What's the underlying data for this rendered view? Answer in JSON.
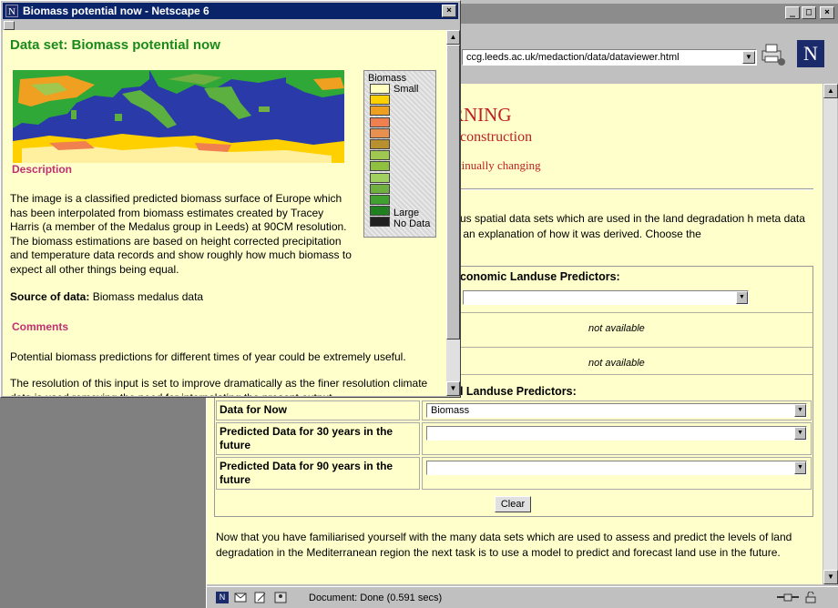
{
  "main_window": {
    "url": "ccg.leeds.ac.uk/medaction/data/dataviewer.html",
    "window_buttons": [
      "_",
      "□",
      "×"
    ],
    "warning_title": "RNING",
    "warning_subtitle": "construction",
    "warning_note": "tinually changing",
    "intro_text": "arious spatial data sets which are used in the land degradation h meta data and an explanation of how it was derived. Choose the",
    "socio_section_title": "economic Landuse Predictors:",
    "not_available_1": "not available",
    "not_available_2": "not available",
    "physical_section_title": "al Landuse Predictors:",
    "predictors": [
      {
        "label": "Data for Now",
        "value": "Biomass"
      },
      {
        "label": "Predicted Data for 30 years in the future",
        "value": ""
      },
      {
        "label": "Predicted Data for 90 years in the future",
        "value": ""
      }
    ],
    "clear_label": "Clear",
    "outro_text": "Now that you have familiarised yourself with the many data sets which are used to assess and predict the levels of land degradation in the Mediterranean region the next task is to use a model to predict and forecast land use in the future.",
    "status_text": "Document: Done (0.591 secs)",
    "logo_letter": "N"
  },
  "popup": {
    "window_title": "Biomass potential now - Netscape 6",
    "icon_letter": "N",
    "close_label": "×",
    "dataset_title": "Data set: Biomass potential now",
    "legend": {
      "title": "Biomass",
      "small_label": "Small",
      "large_label": "Large",
      "nodata_label": "No Data",
      "colors": [
        "#ffffc0",
        "#ffd000",
        "#f0a020",
        "#f08050",
        "#e89050",
        "#b89030",
        "#a0c850",
        "#90c040",
        "#a0d060",
        "#70b040",
        "#40a030",
        "#208020",
        "#202020"
      ]
    },
    "description_heading": "Description",
    "description_text": "The image is a classified predicted biomass surface of Europe which has been interpolated from biomass estimates created by Tracey Harris (a member of the Medalus group in Leeds) at 90CM resolution. The biomass estimations are based on height corrected precipitation and temperature data records and show roughly how much biomass to expect all other things being equal.",
    "source_label": "Source of data:",
    "source_value": "Biomass medalus data",
    "comments_heading": "Comments",
    "comments_text_1": "Potential biomass predictions for different times of year could be extremely useful.",
    "comments_text_2": "The resolution of this input is set to improve dramatically as the finer resolution climate data is used removing the need for interpolating the present output."
  }
}
